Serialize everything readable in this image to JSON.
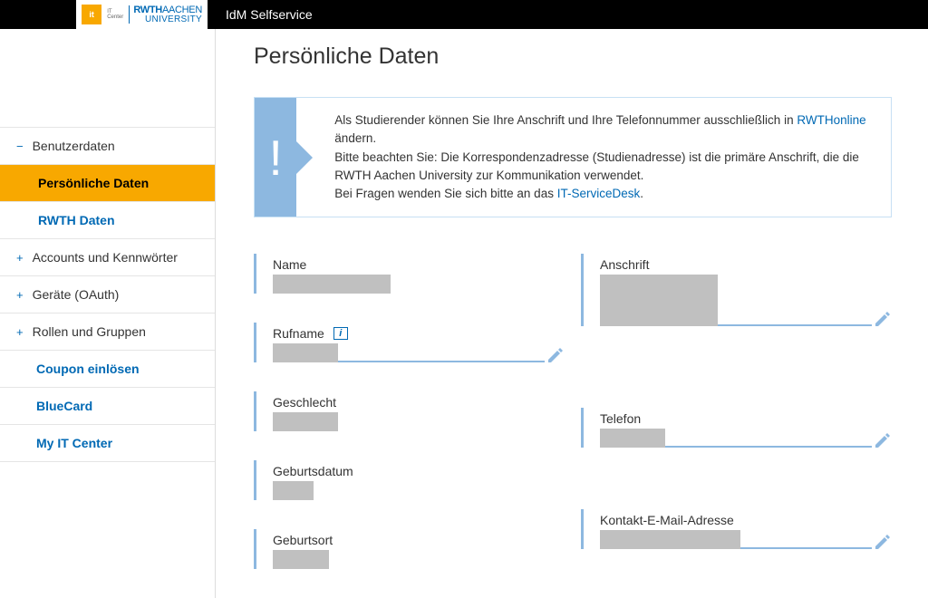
{
  "app_title": "IdM Selfservice",
  "logo": {
    "it": "it",
    "sub": "IT Center",
    "rwth": "RWTH",
    "aachen": "AACHEN",
    "uni": "UNIVERSITY"
  },
  "sidebar": {
    "items": [
      {
        "label": "Benutzerdaten",
        "icon": "−"
      },
      {
        "label": "Persönliche Daten",
        "sub": true,
        "active": true
      },
      {
        "label": "RWTH Daten",
        "sub": true
      },
      {
        "label": "Accounts und Kennwörter",
        "icon": "+"
      },
      {
        "label": "Geräte (OAuth)",
        "icon": "+"
      },
      {
        "label": "Rollen und Gruppen",
        "icon": "+"
      },
      {
        "label": "Coupon einlösen"
      },
      {
        "label": "BlueCard"
      },
      {
        "label": "My IT Center"
      }
    ]
  },
  "page_title": "Persönliche Daten",
  "info": {
    "line1_pre": "Als Studierender können Sie Ihre Anschrift und Ihre Telefonnummer ausschließlich in ",
    "link1": "RWTHonline",
    "line1_post": " ändern.",
    "line2": "Bitte beachten Sie: Die Korrespondenzadresse (Studienadresse) ist die primäre Anschrift, die die RWTH Aachen University zur Kommunikation verwendet.",
    "line3_pre": "Bei Fragen wenden Sie sich bitte an das ",
    "link2": "IT-ServiceDesk",
    "line3_post": "."
  },
  "fields": {
    "name": "Name",
    "rufname": "Rufname",
    "geschlecht": "Geschlecht",
    "geburtsdatum": "Geburtsdatum",
    "geburtsort": "Geburtsort",
    "anschrift": "Anschrift",
    "telefon": "Telefon",
    "email": "Kontakt-E-Mail-Adresse"
  }
}
